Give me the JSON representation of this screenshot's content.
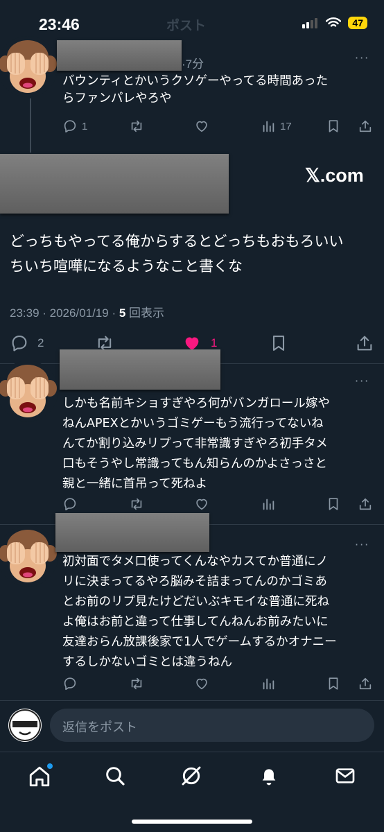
{
  "status_bar": {
    "time": "23:46",
    "faded_title": "ポスト",
    "battery": "47"
  },
  "reply_top": {
    "time_ago": "·7分",
    "text_lines": [
      "バウンティとかいうクソゲーやってる時間あった",
      "らファンパレやろや"
    ],
    "reply_count": "1",
    "view_count": "17"
  },
  "main_tweet": {
    "source": "𝕏.com",
    "text_lines": [
      "どっちもやってる俺からするとどっちもおもろいい",
      "ちいち喧嘩になるようなこと書くな"
    ],
    "timestamp": "23:39 · 2026/01/19 · ",
    "views_number": "5",
    "views_label": " 回表示",
    "reply_count": "2",
    "like_count": "1",
    "like_color": "#f91880"
  },
  "reply_2": {
    "text_lines": [
      "しかも名前キショすぎやろ何がバンガロール嫁や",
      "ねんAPEXとかいうゴミゲーもう流行ってないね",
      "んてか割り込みリプって非常識すぎやろ初手タメ",
      "口もそうやし常識ってもん知らんのかよさっさと",
      "親と一緒に首吊って死ねよ"
    ]
  },
  "reply_3": {
    "text_lines": [
      "初対面でタメ口使ってくんなやカスてか普通にノ",
      "リに決まってるやろ脳みそ詰まってんのかゴミあ",
      "とお前のリプ見たけどだいぶキモイな普通に死ね",
      "よ俺はお前と違って仕事してんねんお前みたいに",
      "友達おらん放課後家で1人でゲームするかオナニー",
      "するしかないゴミとは違うねん"
    ]
  },
  "reply_bar": {
    "placeholder": "返信をポスト"
  },
  "nav": {
    "items": [
      "home-icon",
      "search-icon",
      "grok-icon",
      "notifications-icon",
      "messages-icon"
    ]
  },
  "colors": {
    "background": "#15202b",
    "muted": "#8b98a5",
    "accent": "#1d9bf0",
    "like": "#f91880"
  }
}
